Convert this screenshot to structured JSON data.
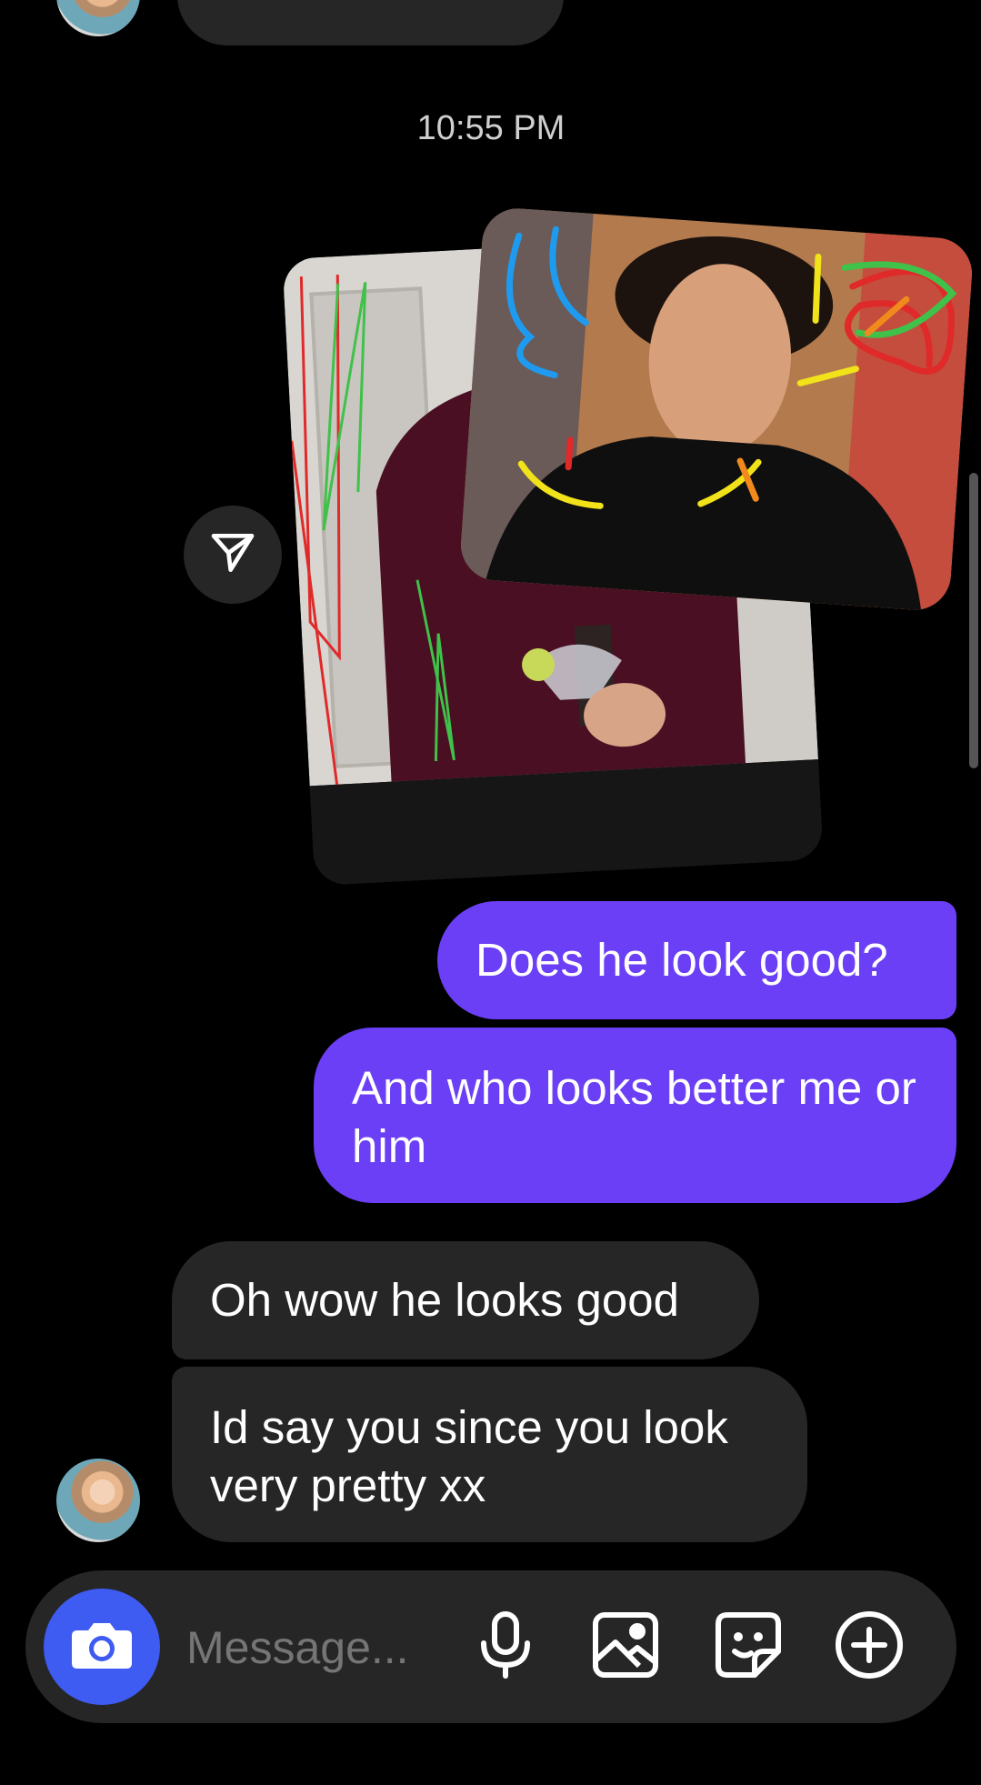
{
  "timestamp": "10:55 PM",
  "messages": {
    "out": [
      {
        "text": "Does he look good?"
      },
      {
        "text": "And who looks better me or him"
      }
    ],
    "in": [
      {
        "text": "Oh wow he looks good"
      },
      {
        "text": "Id say you since you look very pretty xx"
      }
    ]
  },
  "composer": {
    "placeholder": "Message..."
  },
  "colors": {
    "outgoing_bubble": "#6b3ff5",
    "incoming_bubble": "#262626",
    "camera_button": "#3e5bf2",
    "background": "#000000"
  },
  "icons": [
    "send-share-icon",
    "camera-icon",
    "microphone-icon",
    "gallery-icon",
    "sticker-icon",
    "add-icon"
  ]
}
